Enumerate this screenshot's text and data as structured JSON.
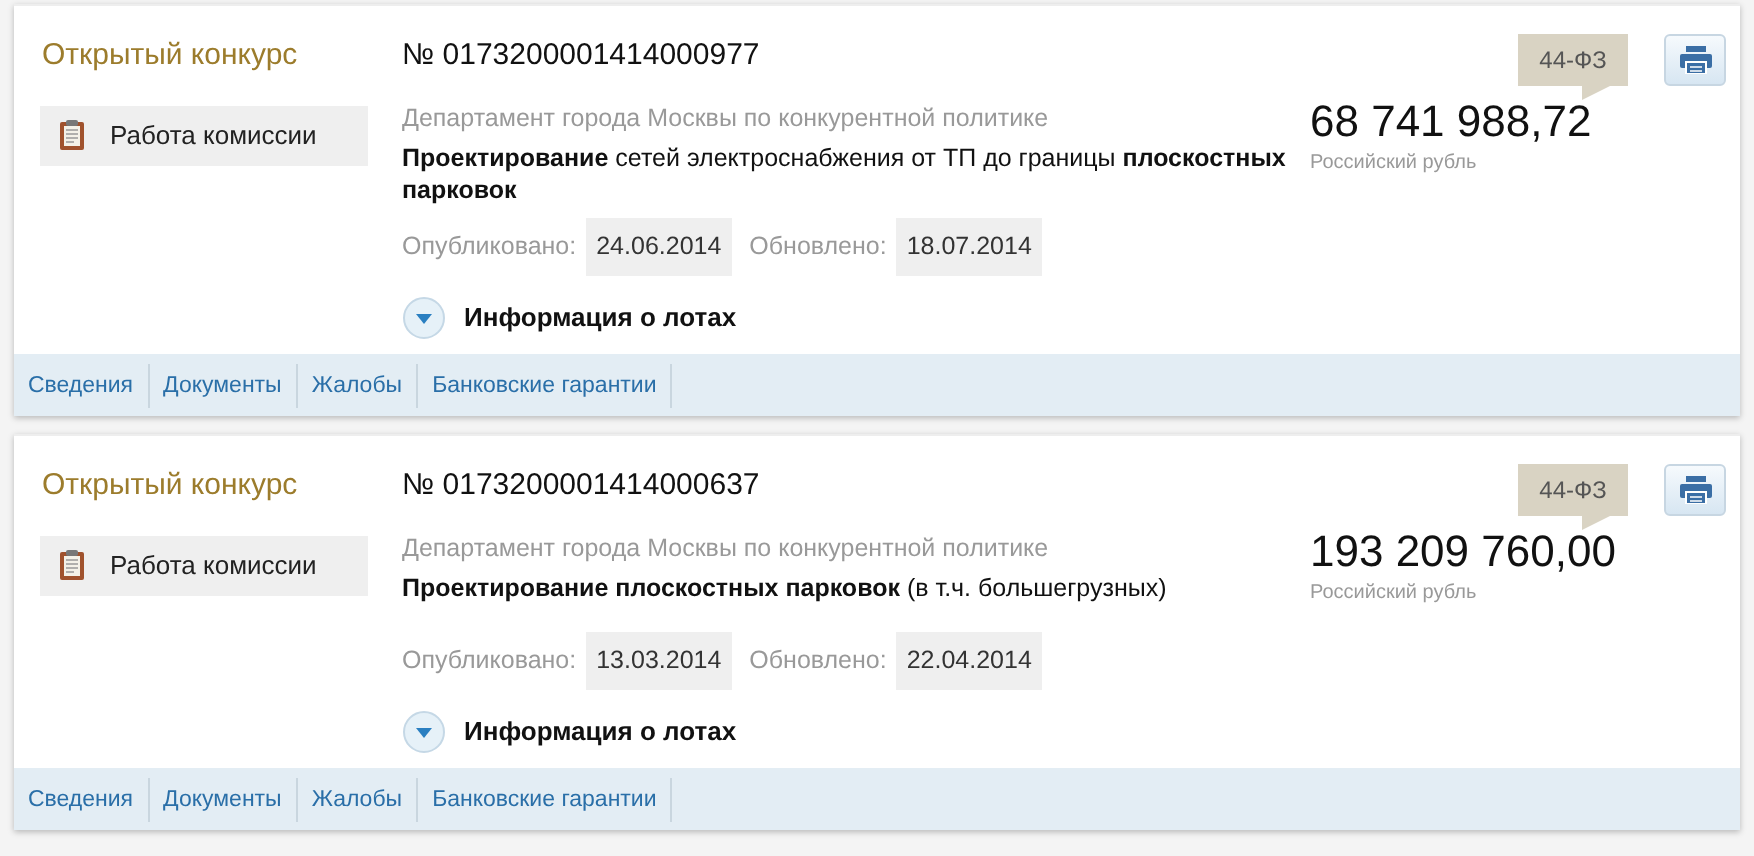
{
  "cards": [
    {
      "type": "Открытый конкурс",
      "stage": "Работа комиссии",
      "number": "№ 0173200001414000977",
      "customer": "Департамент города Москвы по конкурентной политике",
      "description": "**Проектирование** сетей электроснабжения от ТП до границы **плоскостных парковок**",
      "law": "44-ФЗ",
      "price": "68 741 988,72",
      "currency": "Российский рубль",
      "published_label": "Опубликовано:",
      "published": "24.06.2014",
      "updated_label": "Обновлено:",
      "updated": "18.07.2014",
      "lots_label": "Информация о лотах",
      "lots_expanded": false,
      "tabs": [
        "Сведения",
        "Документы",
        "Жалобы",
        "Банковские гарантии"
      ]
    },
    {
      "type": "Открытый конкурс",
      "stage": "Работа комиссии",
      "number": "№ 0173200001414000637",
      "customer": "Департамент города Москвы по конкурентной политике",
      "description": "**Проектирование плоскостных парковок** (в т.ч. большегрузных)",
      "law": "44-ФЗ",
      "price": "193 209 760,00",
      "currency": "Российский рубль",
      "published_label": "Опубликовано:",
      "published": "13.03.2014",
      "updated_label": "Обновлено:",
      "updated": "22.04.2014",
      "lots_label": "Информация о лотах",
      "lots_expanded": false,
      "tabs": [
        "Сведения",
        "Документы",
        "Жалобы",
        "Банковские гарантии"
      ]
    }
  ]
}
